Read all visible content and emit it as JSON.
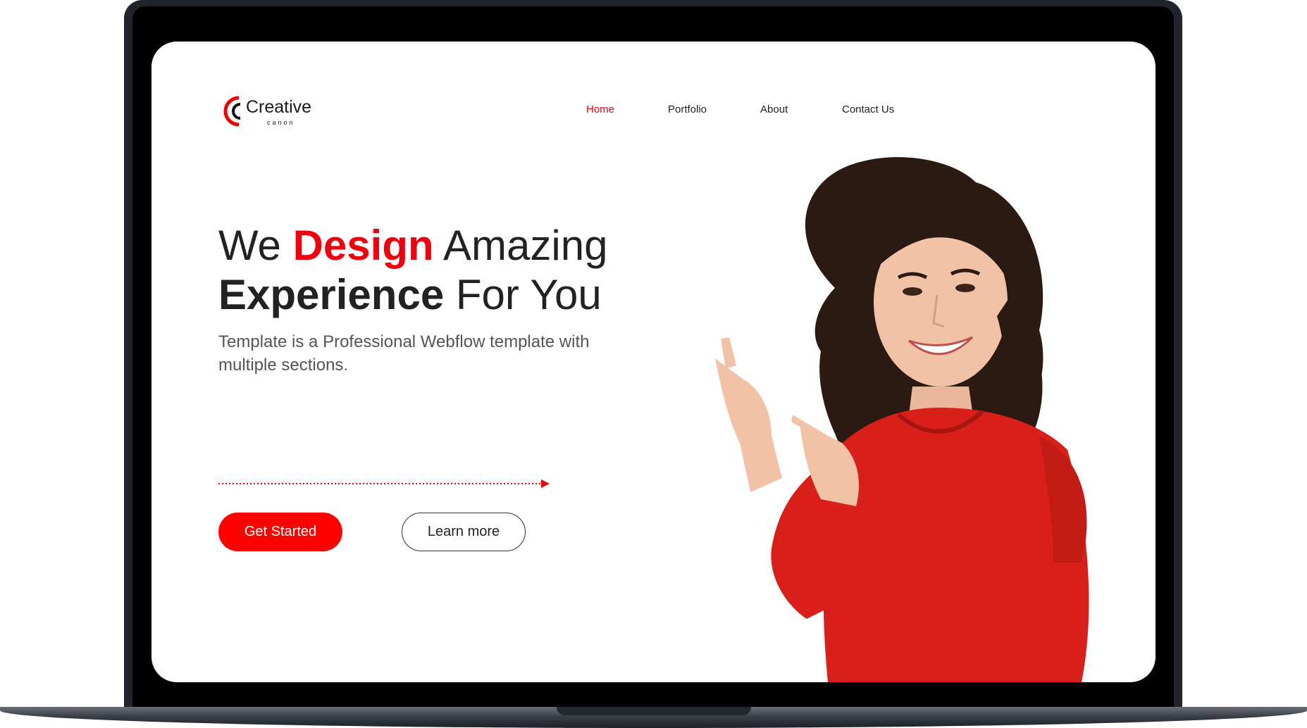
{
  "brand": {
    "name": "Creative",
    "tagline": "canon",
    "accent_color": "#f0000c"
  },
  "nav": {
    "items": [
      {
        "label": "Home",
        "active": true
      },
      {
        "label": "Portfolio",
        "active": false
      },
      {
        "label": "About",
        "active": false
      },
      {
        "label": "Contact Us",
        "active": false
      }
    ]
  },
  "hero": {
    "headline": {
      "part1": "We",
      "accent": "Design",
      "part2": "Amazing",
      "line2_bold": "Experience",
      "line2_rest": "For You"
    },
    "subtext": "Template is a Professional Webflow template with multiple sections.",
    "primary_button": "Get Started",
    "secondary_button": "Learn more"
  }
}
